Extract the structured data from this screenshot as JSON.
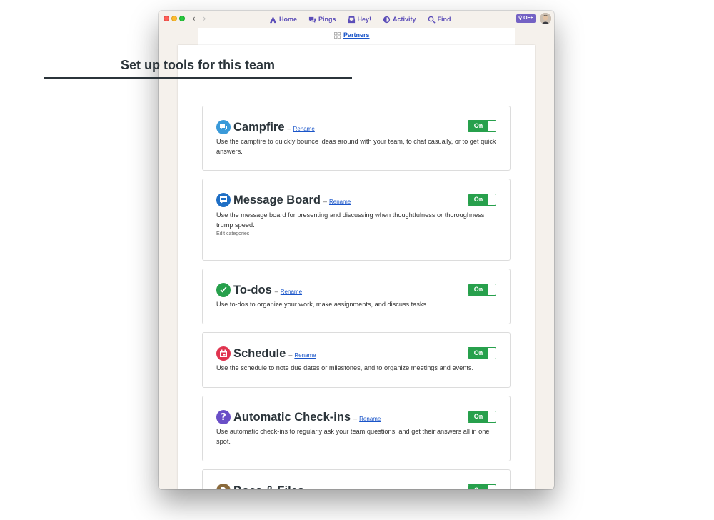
{
  "window": {
    "nav": [
      {
        "label": "Home",
        "icon": "home-icon"
      },
      {
        "label": "Pings",
        "icon": "pings-icon"
      },
      {
        "label": "Hey!",
        "icon": "hey-inbox-icon"
      },
      {
        "label": "Activity",
        "icon": "activity-icon"
      },
      {
        "label": "Find",
        "icon": "search-icon"
      }
    ],
    "off_badge": "OFF"
  },
  "breadcrumb": {
    "label": "Partners"
  },
  "page_title": "Set up tools for this team",
  "toggle_label": "On",
  "rename_label": "Rename",
  "tools": [
    {
      "name": "Campfire",
      "description": "Use the campfire to quickly bounce ideas around with your team, to chat casually, or to get quick answers.",
      "enabled": true,
      "icon": "campfire-icon",
      "color": "#3a9ad9"
    },
    {
      "name": "Message Board",
      "description": "Use the message board for presenting and discussing when thoughtfulness or thoroughness trump speed.",
      "extra_link": "Edit categories",
      "enabled": true,
      "icon": "message-board-icon",
      "color": "#1f6fc5"
    },
    {
      "name": "To-dos",
      "description": "Use to-dos to organize your work, make assignments, and discuss tasks.",
      "enabled": true,
      "icon": "todos-check-icon",
      "color": "#27a04c"
    },
    {
      "name": "Schedule",
      "description": "Use the schedule to note due dates or milestones, and to organize meetings and events.",
      "enabled": true,
      "icon": "schedule-calendar-icon",
      "color": "#e0344f"
    },
    {
      "name": "Automatic Check-ins",
      "description": "Use automatic check-ins to regularly ask your team questions, and get their answers all in one spot.",
      "enabled": true,
      "icon": "checkins-question-icon",
      "color": "#6a4fc7"
    },
    {
      "name": "Docs & Files",
      "enabled": true,
      "icon": "docs-files-icon",
      "color": "#8a6a3c"
    }
  ],
  "colors": {
    "accent_nav": "#5b4db8",
    "toggle_green": "#27a04c",
    "link_blue": "#1a55c9"
  }
}
